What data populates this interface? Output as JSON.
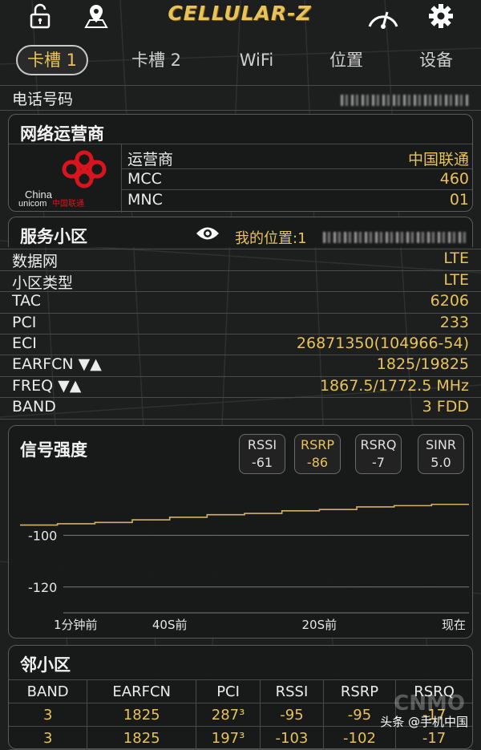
{
  "app": {
    "title": "CELLULAR-Z"
  },
  "icons": {
    "lock": "unlock-icon",
    "location": "location-pin-icon",
    "speed": "speedometer-icon",
    "settings": "gear-icon",
    "eye": "eye-icon"
  },
  "tabs": [
    {
      "label": "卡槽 1",
      "active": true
    },
    {
      "label": "卡槽 2",
      "active": false
    },
    {
      "label": "WiFi",
      "active": false
    },
    {
      "label": "位置",
      "active": false
    },
    {
      "label": "设备",
      "active": false
    }
  ],
  "phone": {
    "label": "电话号码"
  },
  "operator_card": {
    "title": "网络运营商",
    "logo_text": "China unicom中国联通",
    "rows": [
      {
        "label": "运营商",
        "value": "中国联通"
      },
      {
        "label": "MCC",
        "value": "460"
      },
      {
        "label": "MNC",
        "value": "01"
      }
    ]
  },
  "cell_card": {
    "title": "服务小区",
    "my_location_label": "我的位置:1",
    "rows": [
      {
        "label": "数据网",
        "value": "LTE"
      },
      {
        "label": "小区类型",
        "value": "LTE"
      },
      {
        "label": "TAC",
        "value": "6206"
      },
      {
        "label": "PCI",
        "value": "233"
      },
      {
        "label": "ECI",
        "value": "26871350(104966-54)"
      },
      {
        "label": "EARFCN ▼▲",
        "value": "1825/19825"
      },
      {
        "label": "FREQ ▼▲",
        "value": "1867.5/1772.5 MHz"
      },
      {
        "label": "BAND",
        "value": "3 FDD"
      }
    ]
  },
  "signal_card": {
    "title": "信号强度",
    "metrics": [
      {
        "name": "RSSI",
        "value": "-61",
        "selected": false
      },
      {
        "name": "RSRP",
        "value": "-86",
        "selected": true
      },
      {
        "name": "RSRQ",
        "value": "-7",
        "selected": false
      },
      {
        "name": "SINR",
        "value": "5.0",
        "selected": false
      }
    ]
  },
  "chart_data": {
    "type": "line",
    "series": [
      {
        "name": "RSRP",
        "color": "#d4b06a",
        "x": [
          60,
          55,
          50,
          45,
          40,
          35,
          30,
          25,
          20,
          15,
          10,
          5,
          0
        ],
        "values": [
          -96,
          -95.5,
          -95,
          -94,
          -93,
          -92,
          -91.5,
          -90.5,
          -90,
          -89,
          -88.5,
          -88,
          -88
        ]
      }
    ],
    "yticks": [
      -100,
      -120
    ],
    "ylim": [
      -130,
      -80
    ],
    "xtick_labels": [
      "1分钟前",
      "40S前",
      "20S前",
      "现在"
    ],
    "xlim": [
      60,
      0
    ]
  },
  "neighbor_card": {
    "title": "邻小区",
    "columns": [
      "BAND",
      "EARFCN",
      "PCI",
      "RSSI",
      "RSRP",
      "RSRQ"
    ],
    "rows": [
      [
        "3",
        "1825",
        "287³",
        "-95",
        "-95",
        "-17"
      ],
      [
        "3",
        "1825",
        "197³",
        "-103",
        "-102",
        "-17"
      ]
    ]
  },
  "watermark": {
    "text": "头条 @手机中国",
    "cnmo": "CNMO"
  }
}
